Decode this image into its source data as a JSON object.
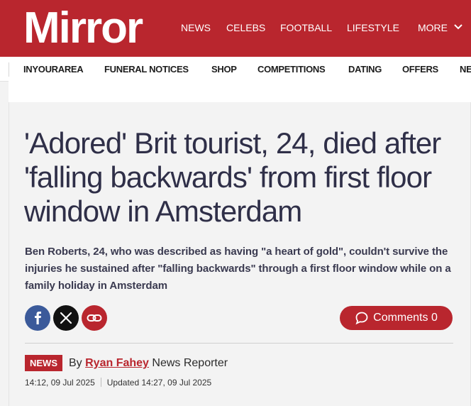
{
  "brand": {
    "logo": "Mirror",
    "accent": "#b9262e"
  },
  "main_nav": [
    "NEWS",
    "CELEBS",
    "FOOTBALL",
    "LIFESTYLE",
    "MORE"
  ],
  "sub_nav": [
    "INYOURAREA",
    "FUNERAL NOTICES",
    "SHOP",
    "COMPETITIONS",
    "DATING",
    "OFFERS",
    "NE"
  ],
  "article": {
    "headline": "'Adored' Brit tourist, 24, died after 'falling backwards' from first floor window in Amsterdam",
    "standfirst": "Ben Roberts, 24, who was described as having \"a heart of gold\", couldn't survive the injuries he sustained after \"falling backwards\" through a first floor window while on a family holiday in Amsterdam",
    "comments_label": "Comments 0",
    "category": "NEWS",
    "by_prefix": "By",
    "author": "Ryan Fahey",
    "author_role": "News Reporter",
    "published": "14:12, 09 Jul 2025",
    "updated": "Updated 14:27, 09 Jul 2025"
  },
  "share_icons": [
    "facebook-icon",
    "x-icon",
    "link-icon"
  ]
}
